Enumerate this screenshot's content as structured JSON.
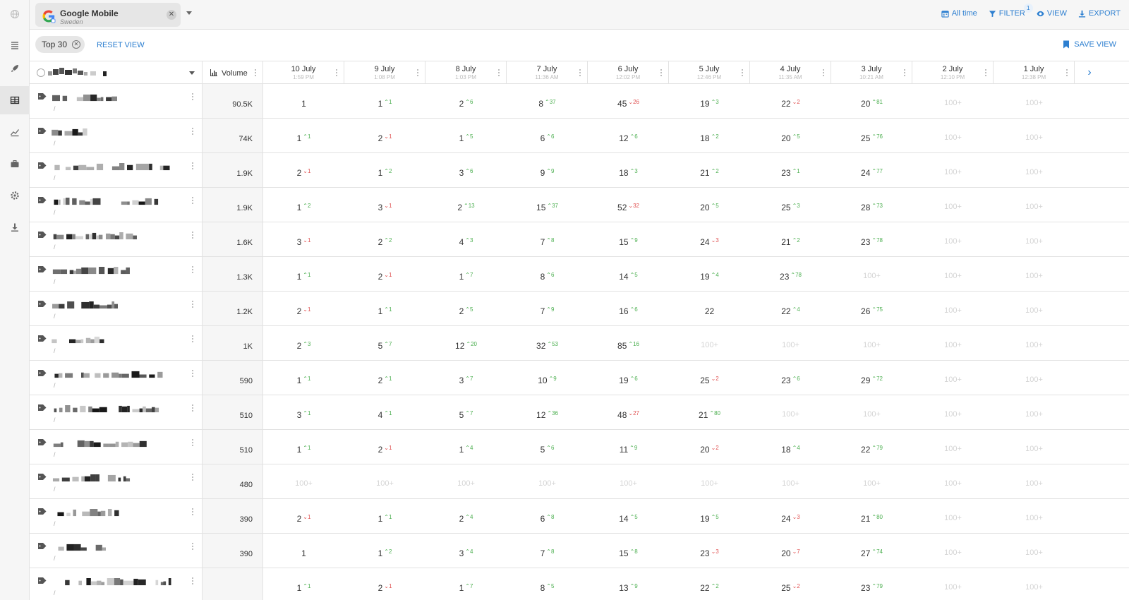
{
  "source": {
    "name": "Google Mobile",
    "region": "Sweden"
  },
  "toolbar": {
    "all_time": "All time",
    "filter": "FILTER",
    "filter_count": "1",
    "view": "VIEW",
    "export": "EXPORT"
  },
  "viewbar": {
    "chip": "Top 30",
    "reset": "RESET VIEW",
    "save": "SAVE VIEW"
  },
  "columns": {
    "volume": "Volume"
  },
  "dates": [
    {
      "label": "10 July",
      "time": "1:59 PM"
    },
    {
      "label": "9 July",
      "time": "1:08 PM"
    },
    {
      "label": "8 July",
      "time": "1:03 PM"
    },
    {
      "label": "7 July",
      "time": "11:36 AM"
    },
    {
      "label": "6 July",
      "time": "12:02 PM"
    },
    {
      "label": "5 July",
      "time": "12:46 PM"
    },
    {
      "label": "4 July",
      "time": "11:35 AM"
    },
    {
      "label": "3 July",
      "time": "10:21 AM"
    },
    {
      "label": "2 July",
      "time": "12:10 PM"
    },
    {
      "label": "1 July",
      "time": "12:38 PM"
    }
  ],
  "rows": [
    {
      "volume": "90.5K",
      "ranks": [
        [
          "1",
          ""
        ],
        [
          "1",
          "+1"
        ],
        [
          "2",
          "+6"
        ],
        [
          "8",
          "+37"
        ],
        [
          "45",
          "-26"
        ],
        [
          "19",
          "+3"
        ],
        [
          "22",
          "-2"
        ],
        [
          "20",
          "+81"
        ],
        [
          "100+",
          ""
        ],
        [
          "100+",
          ""
        ]
      ]
    },
    {
      "volume": "74K",
      "ranks": [
        [
          "1",
          "+1"
        ],
        [
          "2",
          "-1"
        ],
        [
          "1",
          "+5"
        ],
        [
          "6",
          "+6"
        ],
        [
          "12",
          "+6"
        ],
        [
          "18",
          "+2"
        ],
        [
          "20",
          "+5"
        ],
        [
          "25",
          "+76"
        ],
        [
          "100+",
          ""
        ],
        [
          "100+",
          ""
        ]
      ]
    },
    {
      "volume": "1.9K",
      "ranks": [
        [
          "2",
          "-1"
        ],
        [
          "1",
          "+2"
        ],
        [
          "3",
          "+6"
        ],
        [
          "9",
          "+9"
        ],
        [
          "18",
          "+3"
        ],
        [
          "21",
          "+2"
        ],
        [
          "23",
          "+1"
        ],
        [
          "24",
          "+77"
        ],
        [
          "100+",
          ""
        ],
        [
          "100+",
          ""
        ]
      ]
    },
    {
      "volume": "1.9K",
      "ranks": [
        [
          "1",
          "+2"
        ],
        [
          "3",
          "-1"
        ],
        [
          "2",
          "+13"
        ],
        [
          "15",
          "+37"
        ],
        [
          "52",
          "-32"
        ],
        [
          "20",
          "+5"
        ],
        [
          "25",
          "+3"
        ],
        [
          "28",
          "+73"
        ],
        [
          "100+",
          ""
        ],
        [
          "100+",
          ""
        ]
      ]
    },
    {
      "volume": "1.6K",
      "ranks": [
        [
          "3",
          "-1"
        ],
        [
          "2",
          "+2"
        ],
        [
          "4",
          "+3"
        ],
        [
          "7",
          "+8"
        ],
        [
          "15",
          "+9"
        ],
        [
          "24",
          "-3"
        ],
        [
          "21",
          "+2"
        ],
        [
          "23",
          "+78"
        ],
        [
          "100+",
          ""
        ],
        [
          "100+",
          ""
        ]
      ]
    },
    {
      "volume": "1.3K",
      "ranks": [
        [
          "1",
          "+1"
        ],
        [
          "2",
          "-1"
        ],
        [
          "1",
          "+7"
        ],
        [
          "8",
          "+6"
        ],
        [
          "14",
          "+5"
        ],
        [
          "19",
          "+4"
        ],
        [
          "23",
          "+78"
        ],
        [
          "100+",
          ""
        ],
        [
          "100+",
          ""
        ],
        [
          "100+",
          ""
        ]
      ]
    },
    {
      "volume": "1.2K",
      "ranks": [
        [
          "2",
          "-1"
        ],
        [
          "1",
          "+1"
        ],
        [
          "2",
          "+5"
        ],
        [
          "7",
          "+9"
        ],
        [
          "16",
          "+6"
        ],
        [
          "22",
          ""
        ],
        [
          "22",
          "+4"
        ],
        [
          "26",
          "+75"
        ],
        [
          "100+",
          ""
        ],
        [
          "100+",
          ""
        ]
      ]
    },
    {
      "volume": "1K",
      "ranks": [
        [
          "2",
          "+3"
        ],
        [
          "5",
          "+7"
        ],
        [
          "12",
          "+20"
        ],
        [
          "32",
          "+53"
        ],
        [
          "85",
          "+16"
        ],
        [
          "100+",
          ""
        ],
        [
          "100+",
          ""
        ],
        [
          "100+",
          ""
        ],
        [
          "100+",
          ""
        ],
        [
          "100+",
          ""
        ]
      ]
    },
    {
      "volume": "590",
      "ranks": [
        [
          "1",
          "+1"
        ],
        [
          "2",
          "+1"
        ],
        [
          "3",
          "+7"
        ],
        [
          "10",
          "+9"
        ],
        [
          "19",
          "+6"
        ],
        [
          "25",
          "-2"
        ],
        [
          "23",
          "+6"
        ],
        [
          "29",
          "+72"
        ],
        [
          "100+",
          ""
        ],
        [
          "100+",
          ""
        ]
      ]
    },
    {
      "volume": "510",
      "ranks": [
        [
          "3",
          "+1"
        ],
        [
          "4",
          "+1"
        ],
        [
          "5",
          "+7"
        ],
        [
          "12",
          "+36"
        ],
        [
          "48",
          "-27"
        ],
        [
          "21",
          "+80"
        ],
        [
          "100+",
          ""
        ],
        [
          "100+",
          ""
        ],
        [
          "100+",
          ""
        ],
        [
          "100+",
          ""
        ]
      ]
    },
    {
      "volume": "510",
      "ranks": [
        [
          "1",
          "+1"
        ],
        [
          "2",
          "-1"
        ],
        [
          "1",
          "+4"
        ],
        [
          "5",
          "+6"
        ],
        [
          "11",
          "+9"
        ],
        [
          "20",
          "-2"
        ],
        [
          "18",
          "+4"
        ],
        [
          "22",
          "+79"
        ],
        [
          "100+",
          ""
        ],
        [
          "100+",
          ""
        ]
      ]
    },
    {
      "volume": "480",
      "ranks": [
        [
          "100+",
          ""
        ],
        [
          "100+",
          ""
        ],
        [
          "100+",
          ""
        ],
        [
          "100+",
          ""
        ],
        [
          "100+",
          ""
        ],
        [
          "100+",
          ""
        ],
        [
          "100+",
          ""
        ],
        [
          "100+",
          ""
        ],
        [
          "100+",
          ""
        ],
        [
          "100+",
          ""
        ]
      ]
    },
    {
      "volume": "390",
      "ranks": [
        [
          "2",
          "-1"
        ],
        [
          "1",
          "+1"
        ],
        [
          "2",
          "+4"
        ],
        [
          "6",
          "+8"
        ],
        [
          "14",
          "+5"
        ],
        [
          "19",
          "+5"
        ],
        [
          "24",
          "-3"
        ],
        [
          "21",
          "+80"
        ],
        [
          "100+",
          ""
        ],
        [
          "100+",
          ""
        ]
      ]
    },
    {
      "volume": "390",
      "ranks": [
        [
          "1",
          ""
        ],
        [
          "1",
          "+2"
        ],
        [
          "3",
          "+4"
        ],
        [
          "7",
          "+8"
        ],
        [
          "15",
          "+8"
        ],
        [
          "23",
          "-3"
        ],
        [
          "20",
          "-7"
        ],
        [
          "27",
          "+74"
        ],
        [
          "100+",
          ""
        ],
        [
          "100+",
          ""
        ]
      ]
    },
    {
      "volume": "",
      "ranks": [
        [
          "1",
          "+1"
        ],
        [
          "2",
          "-1"
        ],
        [
          "1",
          "+7"
        ],
        [
          "8",
          "+5"
        ],
        [
          "13",
          "+9"
        ],
        [
          "22",
          "+2"
        ],
        [
          "25",
          "-2"
        ],
        [
          "23",
          "+79"
        ],
        [
          "100+",
          ""
        ],
        [
          "100+",
          ""
        ]
      ]
    }
  ],
  "colors": {
    "accent": "#2d7fd0",
    "up": "#4caf50",
    "down": "#e05252"
  }
}
